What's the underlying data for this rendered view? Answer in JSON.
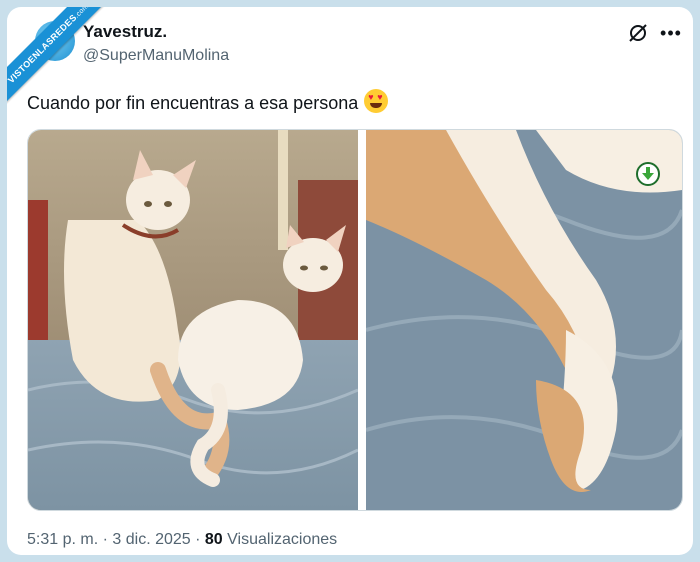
{
  "watermark": {
    "text": "VISTOENLASREDES",
    "suffix": ".com"
  },
  "author": {
    "name": "Yavestruz.",
    "handle": "@SuperManuMolina"
  },
  "tweet": {
    "text": "Cuando por fin encuentras a esa persona",
    "emoji": "smiling-face-with-heart-eyes"
  },
  "media": {
    "images": [
      {
        "label": "two-white-cats-sitting-tails-intertwined"
      },
      {
        "label": "closeup-intertwined-cat-tails"
      }
    ]
  },
  "footer": {
    "time": "5:31 p. m.",
    "separator": "·",
    "date": "3 dic. 2025",
    "views_count": "80",
    "views_label": "Visualizaciones"
  },
  "icons": {
    "grok": "grok-icon",
    "more": "more-options-icon",
    "download": "download-icon"
  },
  "colors": {
    "background": "#c9dfeb",
    "brand": "#1a91d6",
    "text": "#0f1419",
    "muted": "#536471"
  }
}
